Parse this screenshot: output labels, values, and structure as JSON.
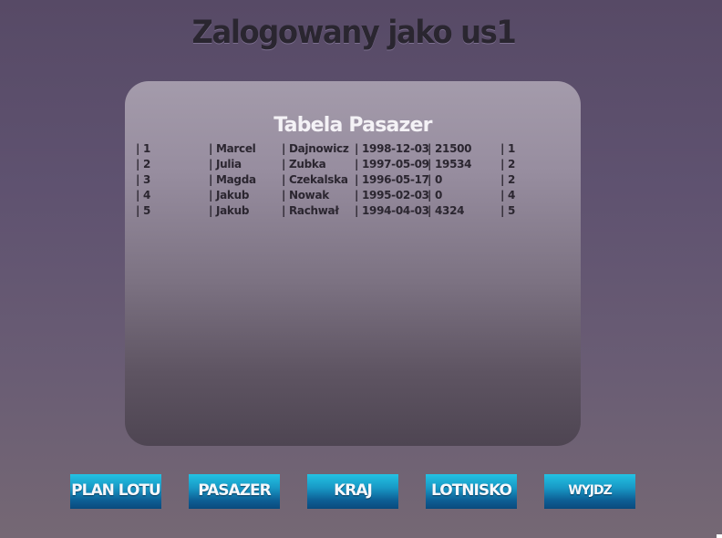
{
  "header": {
    "title": "Zalogowany jako us1"
  },
  "panel": {
    "title": "Tabela Pasazer",
    "rows": [
      [
        "1",
        "Marcel",
        "Dajnowicz",
        "1998-12-03",
        "21500",
        "1"
      ],
      [
        "2",
        "Julia",
        "Zubka",
        "1997-05-09",
        "19534",
        "2"
      ],
      [
        "3",
        "Magda",
        "Czekalska",
        "1996-05-17",
        "0",
        "2"
      ],
      [
        "4",
        "Jakub",
        "Nowak",
        "1995-02-03",
        "0",
        "4"
      ],
      [
        "5",
        "Jakub",
        "Rachwał",
        "1994-04-03",
        "4324",
        "5"
      ]
    ]
  },
  "nav": {
    "buttons": [
      "PLAN LOTU",
      "PASAZER",
      "KRAJ",
      "LOTNISKO",
      "WYJDZ"
    ]
  },
  "colors": {
    "background": "#5f5270",
    "panel_top": "#a49bab",
    "panel_bottom": "#4e4552",
    "button_top": "#23c2e3",
    "button_bottom": "#0a4a7d",
    "title_text": "#2a2630"
  }
}
